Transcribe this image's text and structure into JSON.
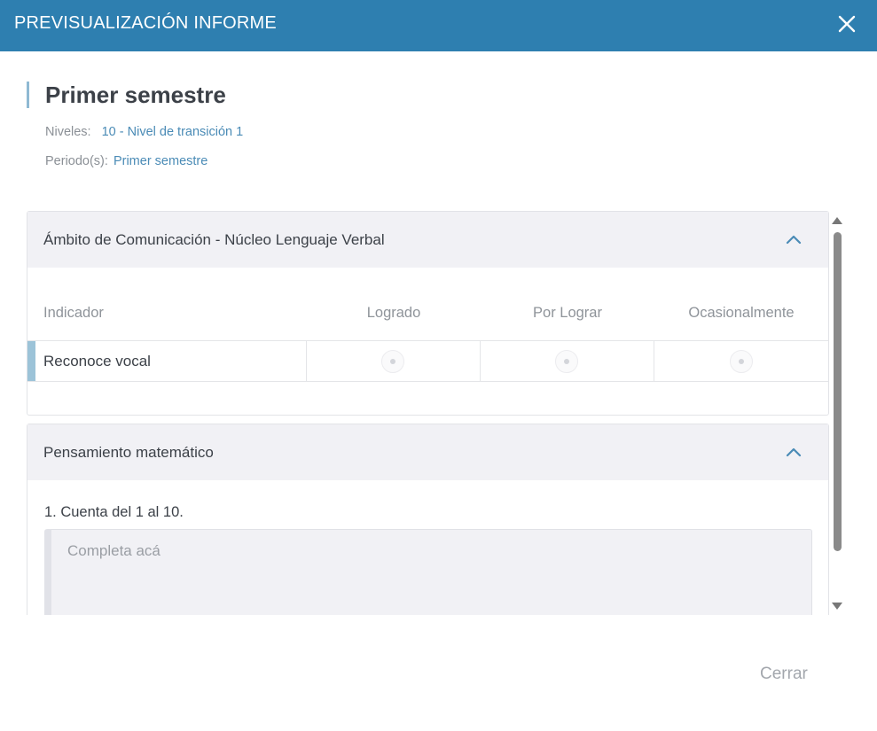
{
  "header": {
    "title": "PREVISUALIZACIÓN INFORME",
    "close_icon": "close-icon"
  },
  "report": {
    "title": "Primer semestre",
    "levels_label": "Niveles:",
    "levels_value": "10 - Nivel de transición 1",
    "period_label": "Periodo(s):",
    "period_value": "Primer semestre"
  },
  "sections": [
    {
      "title": "Ámbito de Comunicación - Núcleo Lenguaje Verbal",
      "columns": [
        "Indicador",
        "Logrado",
        "Por Lograr",
        "Ocasionalmente"
      ],
      "rows": [
        {
          "indicator": "Reconoce vocal"
        }
      ]
    },
    {
      "title": "Pensamiento matemático",
      "question": "1. Cuenta del 1 al 10.",
      "answer_placeholder": "Completa acá"
    }
  ],
  "footer": {
    "close_label": "Cerrar"
  },
  "colors": {
    "header_bg": "#2e7fb0",
    "accent": "#4a8bb6",
    "row_accent": "#9cc3d8"
  }
}
